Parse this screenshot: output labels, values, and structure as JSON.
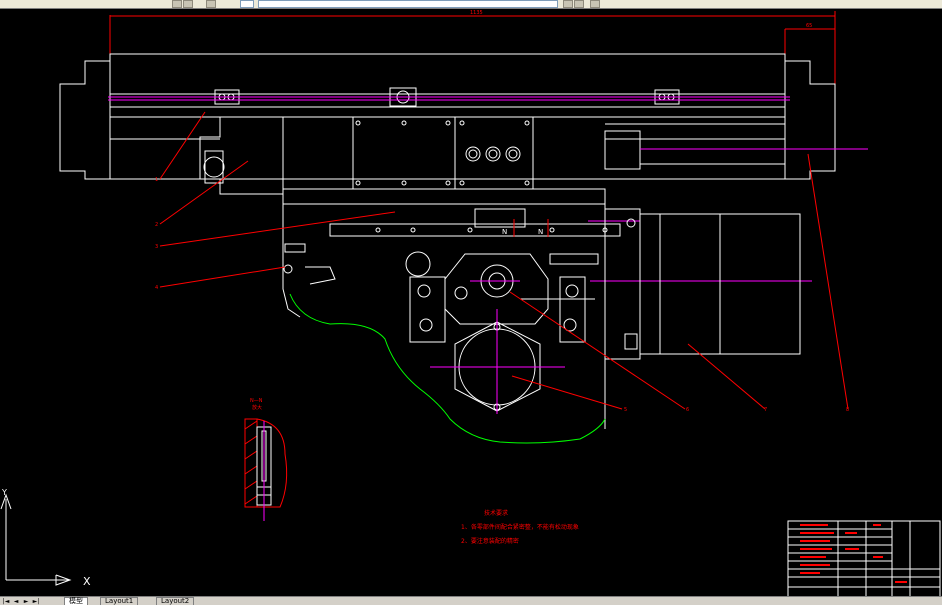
{
  "window": {
    "app": "AutoCAD",
    "view": "Model space"
  },
  "colors": {
    "background": "#000000",
    "geometry": "#ffffff",
    "centerline": "#ff00ff",
    "dimension": "#ff0000",
    "hidden_edge": "#00ff00",
    "note_text": "#ff0000"
  },
  "dimensions": {
    "overall_length": "1135",
    "right_offset": "65"
  },
  "balloons": [
    "1",
    "2",
    "3",
    "4",
    "5",
    "6",
    "7",
    "8"
  ],
  "section_label": {
    "title": "N—N",
    "scale": "放大"
  },
  "section_markers": {
    "left": "N",
    "right": "N"
  },
  "tech_notes": {
    "title": "技术要求",
    "items": [
      "1、各零部件间配合紧密整，不能有松动现象",
      "2、要注意装配的精密"
    ]
  },
  "ucs": {
    "x_label": "X",
    "y_label": "Y"
  },
  "tabs": [
    {
      "label": "模型",
      "active": true
    },
    {
      "label": "Layout1",
      "active": false
    },
    {
      "label": "Layout2",
      "active": false
    }
  ]
}
